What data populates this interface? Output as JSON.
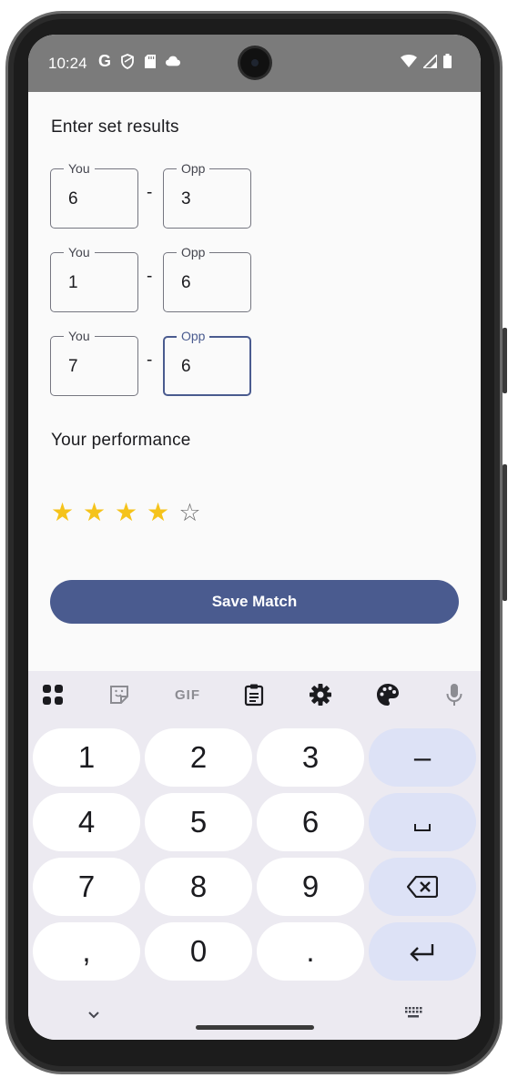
{
  "status_bar": {
    "time": "10:24",
    "left_icons": [
      "google-g-icon",
      "shield-icon",
      "sd-card-icon",
      "cloud-icon"
    ],
    "right_icons": [
      "wifi-icon",
      "signal-icon",
      "battery-icon"
    ],
    "left_glyphs": [
      "G",
      "",
      "",
      ""
    ]
  },
  "screen": {
    "heading": "Enter set results",
    "sets": [
      {
        "you_label": "You",
        "you_value": "6",
        "separator": "-",
        "opp_label": "Opp",
        "opp_value": "3"
      },
      {
        "you_label": "You",
        "you_value": "1",
        "separator": "-",
        "opp_label": "Opp",
        "opp_value": "6"
      },
      {
        "you_label": "You",
        "you_value": "7",
        "separator": "-",
        "opp_label": "Opp",
        "opp_value": "6",
        "opp_focused": true
      }
    ],
    "performance_label": "Your performance",
    "rating": {
      "value": 4,
      "max": 5,
      "filled_glyph": "★",
      "empty_glyph": "☆"
    },
    "save_label": "Save Match"
  },
  "keyboard": {
    "toolbar": [
      "apps-grid-icon",
      "sticker-icon",
      "gif-icon",
      "clipboard-icon",
      "settings-icon",
      "palette-icon",
      "mic-icon"
    ],
    "gif_label": "GIF",
    "rows": [
      [
        "1",
        "2",
        "3",
        "–"
      ],
      [
        "4",
        "5",
        "6",
        "␣"
      ],
      [
        "7",
        "8",
        "9",
        "⌫"
      ],
      [
        ",",
        "0",
        ".",
        "↵"
      ]
    ],
    "bottom_left_icon": "chevron-down-icon",
    "bottom_right_icon": "keyboard-icon"
  }
}
